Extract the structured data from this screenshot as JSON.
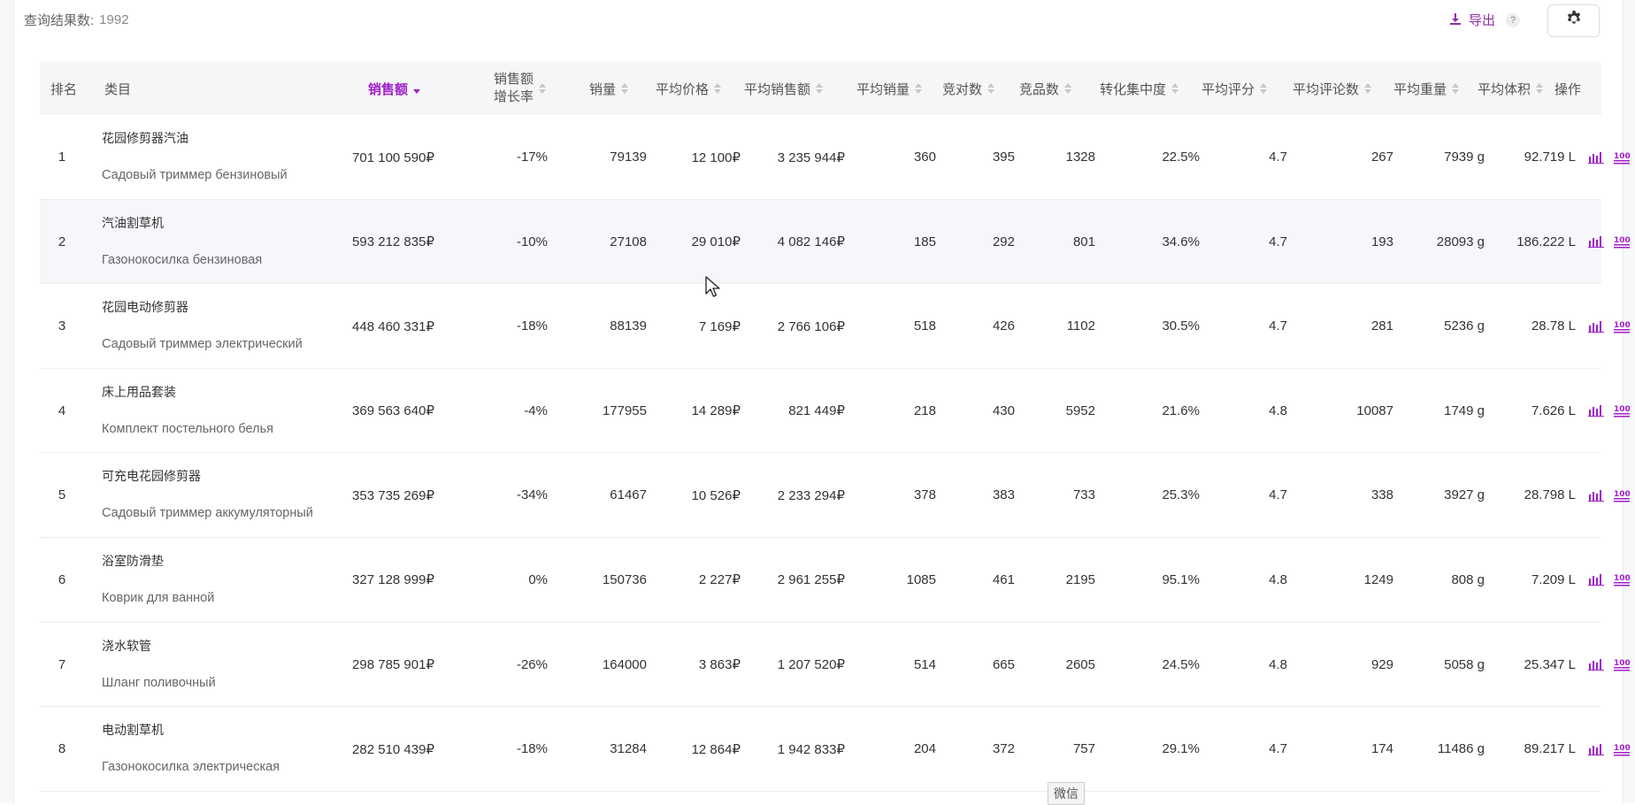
{
  "toolbar": {
    "result_label": "查询结果数:",
    "result_count": "1992",
    "export_label": "导出",
    "help_label": "?",
    "accent_color": "#a020c8"
  },
  "columns": {
    "rank": "排名",
    "category": "类目",
    "sales": "销售额",
    "growth_line1": "销售额",
    "growth_line2": "增长率",
    "volume": "销量",
    "avg_price": "平均价格",
    "avg_sales": "平均销售额",
    "avg_volume": "平均销量",
    "competitors": "竞对数",
    "products": "竞品数",
    "conversion": "转化集中度",
    "avg_rating": "平均评分",
    "avg_reviews": "平均评论数",
    "avg_weight": "平均重量",
    "avg_volume_size": "平均体积",
    "actions": "操作"
  },
  "rows": [
    {
      "rank": "1",
      "zh": "花园修剪器汽油",
      "ru": "Садовый триммер бензиновый",
      "sales": "701 100 590₽",
      "growth": "-17%",
      "volume": "79139",
      "avg_price": "12 100₽",
      "avg_sales": "3 235 944₽",
      "avg_volume": "360",
      "competitors": "395",
      "products": "1328",
      "conversion": "22.5%",
      "rating": "4.7",
      "reviews": "267",
      "weight": "7939 g",
      "size": "92.719 L"
    },
    {
      "rank": "2",
      "zh": "汽油割草机",
      "ru": "Газонокосилка бензиновая",
      "sales": "593 212 835₽",
      "growth": "-10%",
      "volume": "27108",
      "avg_price": "29 010₽",
      "avg_sales": "4 082 146₽",
      "avg_volume": "185",
      "competitors": "292",
      "products": "801",
      "conversion": "34.6%",
      "rating": "4.7",
      "reviews": "193",
      "weight": "28093 g",
      "size": "186.222 L"
    },
    {
      "rank": "3",
      "zh": "花园电动修剪器",
      "ru": "Садовый триммер электрический",
      "sales": "448 460 331₽",
      "growth": "-18%",
      "volume": "88139",
      "avg_price": "7 169₽",
      "avg_sales": "2 766 106₽",
      "avg_volume": "518",
      "competitors": "426",
      "products": "1102",
      "conversion": "30.5%",
      "rating": "4.7",
      "reviews": "281",
      "weight": "5236 g",
      "size": "28.78 L"
    },
    {
      "rank": "4",
      "zh": "床上用品套装",
      "ru": "Комплект постельного белья",
      "sales": "369 563 640₽",
      "growth": "-4%",
      "volume": "177955",
      "avg_price": "14 289₽",
      "avg_sales": "821 449₽",
      "avg_volume": "218",
      "competitors": "430",
      "products": "5952",
      "conversion": "21.6%",
      "rating": "4.8",
      "reviews": "10087",
      "weight": "1749 g",
      "size": "7.626 L"
    },
    {
      "rank": "5",
      "zh": "可充电花园修剪器",
      "ru": "Садовый триммер аккумуляторный",
      "sales": "353 735 269₽",
      "growth": "-34%",
      "volume": "61467",
      "avg_price": "10 526₽",
      "avg_sales": "2 233 294₽",
      "avg_volume": "378",
      "competitors": "383",
      "products": "733",
      "conversion": "25.3%",
      "rating": "4.7",
      "reviews": "338",
      "weight": "3927 g",
      "size": "28.798 L"
    },
    {
      "rank": "6",
      "zh": "浴室防滑垫",
      "ru": "Коврик для ванной",
      "sales": "327 128 999₽",
      "growth": "0%",
      "volume": "150736",
      "avg_price": "2 227₽",
      "avg_sales": "2 961 255₽",
      "avg_volume": "1085",
      "competitors": "461",
      "products": "2195",
      "conversion": "95.1%",
      "rating": "4.8",
      "reviews": "1249",
      "weight": "808 g",
      "size": "7.209 L"
    },
    {
      "rank": "7",
      "zh": "浇水软管",
      "ru": "Шланг поливочный",
      "sales": "298 785 901₽",
      "growth": "-26%",
      "volume": "164000",
      "avg_price": "3 863₽",
      "avg_sales": "1 207 520₽",
      "avg_volume": "514",
      "competitors": "665",
      "products": "2605",
      "conversion": "24.5%",
      "rating": "4.8",
      "reviews": "929",
      "weight": "5058 g",
      "size": "25.347 L"
    },
    {
      "rank": "8",
      "zh": "电动割草机",
      "ru": "Газонокосилка электрическая",
      "sales": "282 510 439₽",
      "growth": "-18%",
      "volume": "31284",
      "avg_price": "12 864₽",
      "avg_sales": "1 942 833₽",
      "avg_volume": "204",
      "competitors": "372",
      "products": "757",
      "conversion": "29.1%",
      "rating": "4.7",
      "reviews": "174",
      "weight": "11486 g",
      "size": "89.217 L"
    }
  ],
  "tooltip": "微信"
}
